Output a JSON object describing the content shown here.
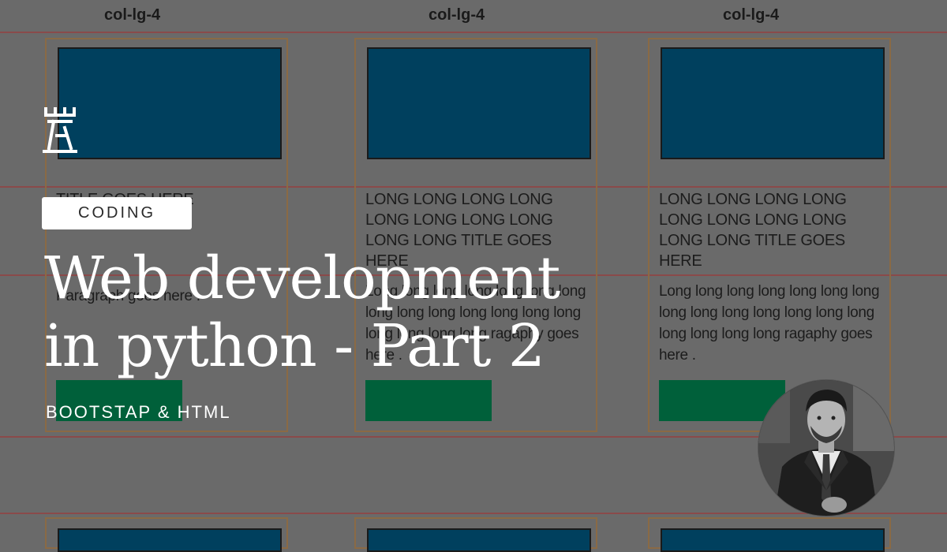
{
  "grid": {
    "col_labels": [
      "col-lg-4",
      "col-lg-4",
      "col-lg-4"
    ],
    "cards": [
      {
        "title": "TITLE GOES HERE",
        "text": "Paragraph goes here ."
      },
      {
        "title": "LONG LONG LONG LONG LONG LONG LONG LONG  LONG LONG TITLE GOES HERE",
        "text": "Long long long long  long long long long long long  long long long long long long  long long ragaphy goes here ."
      },
      {
        "title": "LONG LONG LONG LONG LONG LONG LONG LONG  LONG LONG TITLE GOES HERE",
        "text": "Long long long long  long  long long long long long  long  long long long long long  long  long ragaphy goes here ."
      }
    ]
  },
  "overlay": {
    "logo_icon": "castle-tower-icon",
    "category": "CODING",
    "headline_line1": "Web development",
    "headline_line2": "in python - Part 2",
    "subtitle": "BOOTSTAP & HTML",
    "avatar": "presenter-avatar"
  },
  "colors": {
    "background": "#6a6a6a",
    "card_image": "#00405e",
    "card_button": "#00603a",
    "grid_line": "#8a4a4a",
    "card_border": "#8a6a45",
    "text_white": "#ffffff"
  }
}
